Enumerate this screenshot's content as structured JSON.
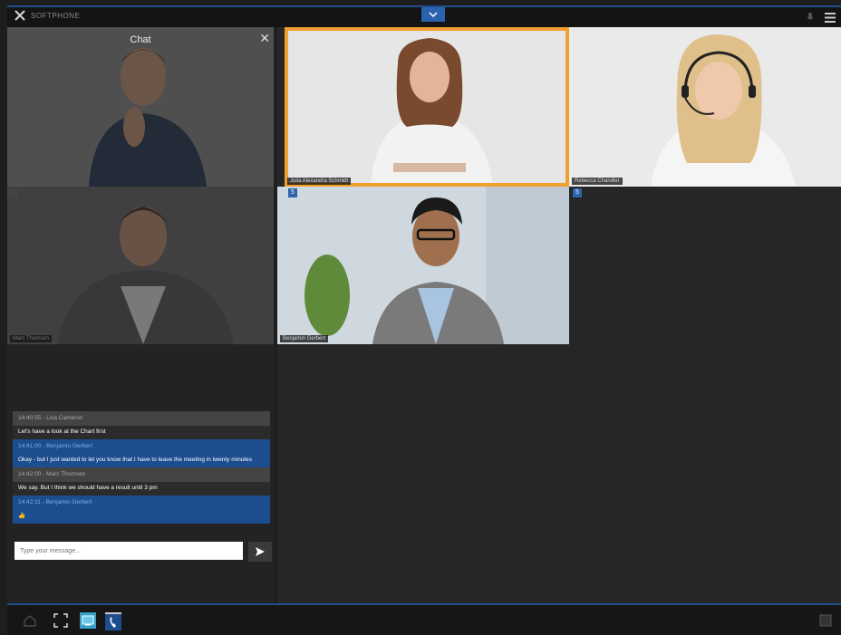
{
  "topbar": {
    "app_name": "SOFTPHONE",
    "colors": {
      "accent": "#2a62ad",
      "bar": "#141414"
    }
  },
  "chat": {
    "title": "Chat",
    "messages": [
      {
        "meta": "14:40:55 - Lisa Cameron",
        "text": "Let's have a look at the Chart first",
        "self": false
      },
      {
        "meta": "14:41:00 - Benjamin Gerbert",
        "text": "Okay - but I just wanted to let you know that I have to leave the meeting in twenty minutes",
        "self": true
      },
      {
        "meta": "14:42:00 - Marc Thomsen",
        "text": "We say. But I think we should have a result until 3 pm",
        "self": false
      },
      {
        "meta": "14:42:11 - Benjamin Gerbert",
        "text": "👍",
        "self": true
      }
    ],
    "input_placeholder": "Type your message..."
  },
  "tiles": {
    "left_top": {
      "label": ""
    },
    "left_bottom": {
      "label": "Marc Thomsen"
    },
    "main_top_center": {
      "label": "Julia Alexandra Schmidt",
      "badge": ""
    },
    "main_top_right": {
      "label": "Rebecca Chandler",
      "badge": ""
    },
    "main_bottom_center": {
      "label": "Benjamin Gerbert",
      "badge": "5"
    },
    "main_bottom_right_badge": "5"
  },
  "colors": {
    "active_speaker": "#f0a030",
    "self_message": "#1c4d8f"
  }
}
